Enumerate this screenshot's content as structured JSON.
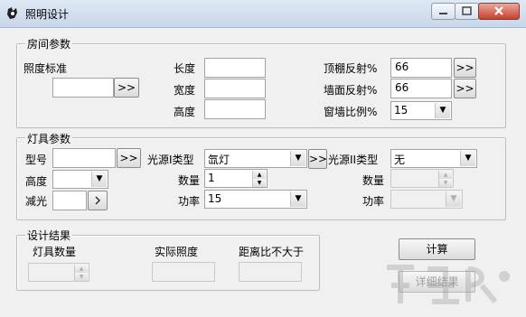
{
  "window": {
    "title": "照明设计"
  },
  "room": {
    "legend": "房间参数",
    "illum_std_label": "照度标准",
    "illum_std_value": "",
    "illum_btn": ">>",
    "length_label": "长度",
    "length_value": "",
    "width_label": "宽度",
    "width_value": "",
    "height_label": "高度",
    "height_value": "",
    "ceiling_label": "顶棚反射%",
    "ceiling_value": "66",
    "ceiling_btn": ">>",
    "wall_label": "墙面反射%",
    "wall_value": "66",
    "wall_btn": ">>",
    "window_ratio_label": "窗墙比例%",
    "window_ratio_value": "15"
  },
  "lamp": {
    "legend": "灯具参数",
    "model_label": "型号",
    "model_value": "",
    "model_btn": ">>",
    "height_label": "高度",
    "height_value": "",
    "dim_label": "减光",
    "dim_value": "",
    "src1_type_label": "光源I类型",
    "src1_type_value": "氙灯",
    "src1_btn": ">>",
    "count1_label": "数量",
    "count1_value": "1",
    "power1_label": "功率",
    "power1_value": "15",
    "src2_type_label": "光源II类型",
    "src2_type_value": "无",
    "count2_label": "数量",
    "count2_value": "",
    "power2_label": "功率",
    "power2_value": ""
  },
  "result": {
    "legend": "设计结果",
    "lamp_count_label": "灯具数量",
    "lamp_count_value": "",
    "actual_illum_label": "实际照度",
    "actual_illum_value": "",
    "distance_ratio_label": "距离比不大于",
    "distance_ratio_value": ""
  },
  "actions": {
    "calc_label": "计算",
    "detail_label": "详细结果"
  },
  "icons": {
    "app": "app-icon",
    "minimize": "minimize-icon",
    "maximize": "maximize-icon",
    "close": "close-icon",
    "dropdown": "chevron-down-icon"
  },
  "colors": {
    "titlebar": "#c7d6ea",
    "close": "#c7402c"
  }
}
